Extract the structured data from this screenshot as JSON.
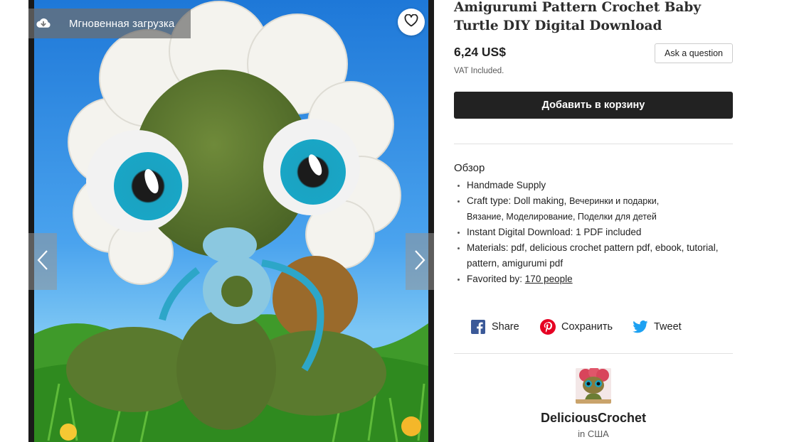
{
  "listing": {
    "title": "Amigurumi Pattern Crochet Baby Turtle DIY Digital Download",
    "price": "6,24 US$",
    "vat_note": "VAT Included.",
    "ask_question_label": "Ask a question",
    "add_to_cart_label": "Добавить в корзину"
  },
  "gallery": {
    "instant_download_label": "Мгновенная загрузка",
    "icons": {
      "download": "cloud-download-icon",
      "favorite": "heart-icon",
      "prev": "chevron-left-icon",
      "next": "chevron-right-icon"
    }
  },
  "overview": {
    "heading": "Обзор",
    "item_supply": "Handmade Supply",
    "craft_type_label": "Craft type: Doll making, ",
    "craft_type_rest_line1": "Вечеринки и подарки,",
    "craft_type_rest_line2": "Вязание, Моделирование, Поделки для детей",
    "instant_download": "Instant Digital Download: 1 PDF included",
    "materials": "Materials: pdf, delicious crochet pattern pdf, ebook, tutorial, pattern, amigurumi pdf",
    "favorited_label": "Favorited by: ",
    "favorited_link": "170 people"
  },
  "share": {
    "facebook_label": "Share",
    "pinterest_label": "Сохранить",
    "twitter_label": "Tweet",
    "colors": {
      "facebook": "#3b5998",
      "pinterest": "#e60023",
      "twitter": "#1da1f2"
    }
  },
  "shop": {
    "name": "DeliciousCrochet",
    "location": "in США"
  },
  "colors": {
    "primary_button": "#222222",
    "text": "#222222",
    "muted": "#595959"
  }
}
